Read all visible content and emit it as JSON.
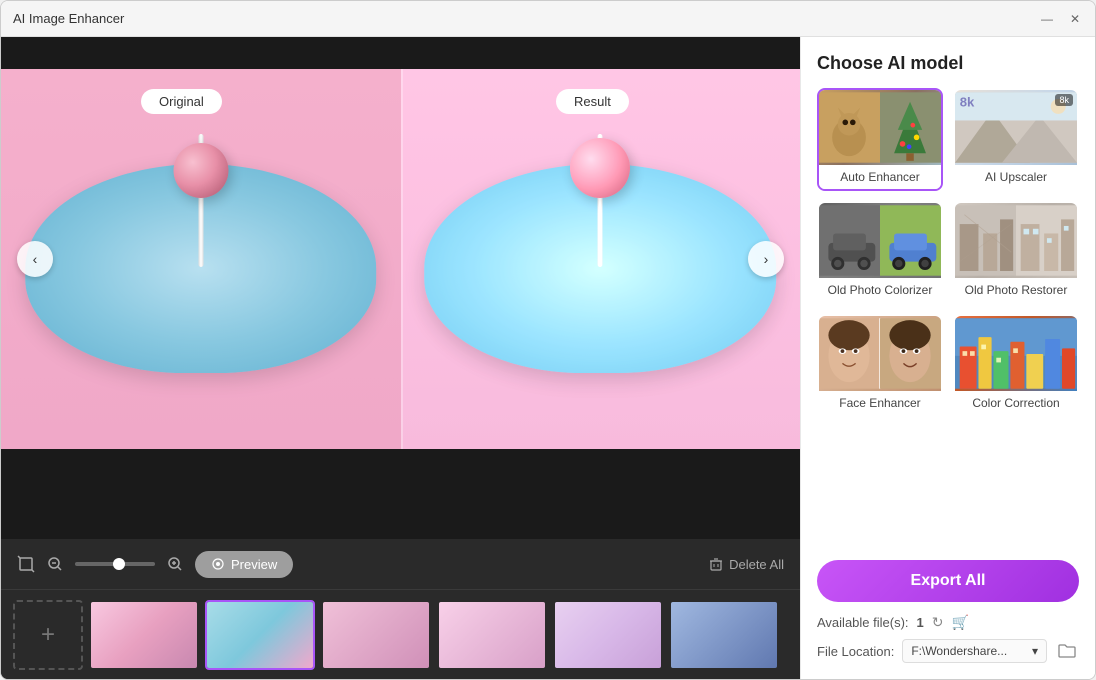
{
  "window": {
    "title": "AI Image Enhancer",
    "minimize_label": "—",
    "close_label": "✕"
  },
  "viewer": {
    "original_label": "Original",
    "result_label": "Result",
    "prev_arrow": "‹",
    "next_arrow": "›"
  },
  "toolbar": {
    "preview_label": "Preview",
    "delete_all_label": "Delete All"
  },
  "ai_panel": {
    "section_title": "Choose AI model",
    "models": [
      {
        "id": "auto-enhancer",
        "label": "Auto Enhancer",
        "selected": true
      },
      {
        "id": "ai-upscaler",
        "label": "AI Upscaler",
        "badge": "8k",
        "selected": false
      },
      {
        "id": "old-colorizer",
        "label": "Old Photo Colorizer",
        "selected": false
      },
      {
        "id": "old-restorer",
        "label": "Old Photo Restorer",
        "selected": false
      },
      {
        "id": "face-enhancer",
        "label": "Face Enhancer",
        "selected": false
      },
      {
        "id": "color-correction",
        "label": "Color Correction",
        "selected": false
      }
    ],
    "export_label": "Export All",
    "available_files_label": "Available file(s):",
    "available_count": "1",
    "file_location_label": "File Location:",
    "file_path": "F:\\Wondershare..."
  }
}
